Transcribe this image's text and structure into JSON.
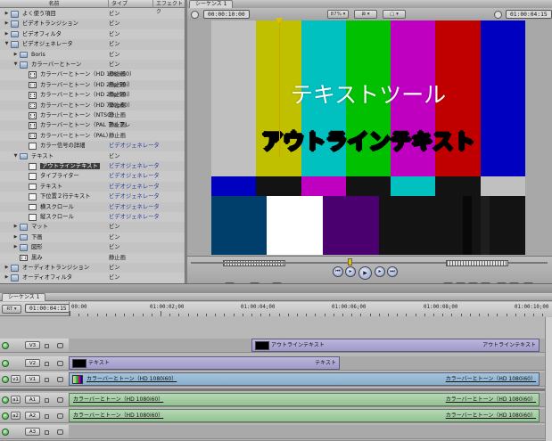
{
  "browser": {
    "columns": [
      "名前",
      "タイプ",
      "エフェクトク"
    ],
    "rows": [
      {
        "label": "よく使う項目",
        "type": "ビン",
        "indent": 0,
        "icon": "folder-icon",
        "tri": "right"
      },
      {
        "label": "ビデオトランジション",
        "type": "ビン",
        "indent": 0,
        "icon": "folder-icon",
        "tri": "right"
      },
      {
        "label": "ビデオフィルタ",
        "type": "ビン",
        "indent": 0,
        "icon": "folder-icon",
        "tri": "right"
      },
      {
        "label": "ビデオジェネレータ",
        "type": "ビン",
        "indent": 0,
        "icon": "folder-icon",
        "tri": "down"
      },
      {
        "label": "Boris",
        "type": "ビン",
        "indent": 1,
        "icon": "folder-icon",
        "tri": "right"
      },
      {
        "label": "カラーバーとトーン",
        "type": "ビン",
        "indent": 1,
        "icon": "folder-icon",
        "tri": "down"
      },
      {
        "label": "カラーバーとトーン（HD 1080i60）",
        "type": "静止画",
        "indent": 2,
        "icon": "clip-icon",
        "tri": ""
      },
      {
        "label": "カラーバーとトーン（HD 25p/50i）",
        "type": "静止画",
        "indent": 2,
        "icon": "clip-icon",
        "tri": ""
      },
      {
        "label": "カラーバーとトーン（HD 25p/50i）",
        "type": "静止画",
        "indent": 2,
        "icon": "clip-icon",
        "tri": ""
      },
      {
        "label": "カラーバーとトーン（HD 720p60）",
        "type": "静止画",
        "indent": 2,
        "icon": "clip-icon",
        "tri": ""
      },
      {
        "label": "カラーバーとトーン（NTSC）",
        "type": "静止画",
        "indent": 2,
        "icon": "clip-icon",
        "tri": ""
      },
      {
        "label": "カラーバーとトーン（PAL フルフレ",
        "type": "静止画",
        "indent": 2,
        "icon": "clip-icon",
        "tri": ""
      },
      {
        "label": "カラーバーとトーン（PAL）",
        "type": "静止画",
        "indent": 2,
        "icon": "clip-icon",
        "tri": ""
      },
      {
        "label": "カラー信号の詳細",
        "type": "ビデオジェネレータ",
        "indent": 2,
        "icon": "generator-icon",
        "tri": ""
      },
      {
        "label": "テキスト",
        "type": "ビン",
        "indent": 1,
        "icon": "folder-icon",
        "tri": "down"
      },
      {
        "label": "アウトラインテキスト",
        "type": "ビデオジェネレータ",
        "indent": 2,
        "icon": "generator-icon",
        "tri": "",
        "selected": true
      },
      {
        "label": "タイプライター",
        "type": "ビデオジェネレータ",
        "indent": 2,
        "icon": "generator-icon",
        "tri": ""
      },
      {
        "label": "テキスト",
        "type": "ビデオジェネレータ",
        "indent": 2,
        "icon": "generator-icon",
        "tri": ""
      },
      {
        "label": "下位置２行テキスト",
        "type": "ビデオジェネレータ",
        "indent": 2,
        "icon": "generator-icon",
        "tri": ""
      },
      {
        "label": "横スクロール",
        "type": "ビデオジェネレータ",
        "indent": 2,
        "icon": "generator-icon",
        "tri": ""
      },
      {
        "label": "縦スクロール",
        "type": "ビデオジェネレータ",
        "indent": 2,
        "icon": "generator-icon",
        "tri": ""
      },
      {
        "label": "マット",
        "type": "ビン",
        "indent": 1,
        "icon": "folder-icon",
        "tri": "right"
      },
      {
        "label": "下画",
        "type": "ビン",
        "indent": 1,
        "icon": "folder-icon",
        "tri": "right"
      },
      {
        "label": "図形",
        "type": "ビン",
        "indent": 1,
        "icon": "folder-icon",
        "tri": "right"
      },
      {
        "label": "黒み",
        "type": "静止画",
        "indent": 1,
        "icon": "clip-icon",
        "tri": ""
      },
      {
        "label": "オーディオトランジション",
        "type": "ビン",
        "indent": 0,
        "icon": "folder-icon",
        "tri": "right"
      },
      {
        "label": "オーディオフィルタ",
        "type": "ビン",
        "indent": 0,
        "icon": "folder-icon",
        "tri": "right"
      }
    ]
  },
  "canvas": {
    "tab": "シーケンス 1",
    "duration_timecode": "00:00:10:00",
    "zoom": "87%",
    "current_timecode": "01:00:04:15",
    "overlay_text_top": "テキストツール",
    "overlay_text_outline": "アウトラインテキスト",
    "colors": {
      "bars_top": [
        "#c0c0c0",
        "#c0c000",
        "#00c0c0",
        "#00c000",
        "#c000c0",
        "#c00000",
        "#0000c0"
      ],
      "bars_mid": [
        "#0000c0",
        "#131313",
        "#c000c0",
        "#131313",
        "#00c0c0",
        "#131313",
        "#c0c0c0"
      ]
    }
  },
  "timeline": {
    "tab": "シーケンス 1",
    "render_button": "RT",
    "timecode": "01:00:04:15",
    "ruler_labels": [
      "00:00",
      "01:00:02;00",
      "01:00:04;00",
      "01:00:06;00",
      "01:00:08;00",
      "01:00:10;00"
    ],
    "tracks": {
      "v3": {
        "label": "V3",
        "clip": "アウトラインテキスト",
        "clip_end_label": "アウトラインテキスト"
      },
      "v2": {
        "label": "V2",
        "clip": "テキスト",
        "clip_end_label": "テキスト"
      },
      "v1": {
        "src": "v1",
        "label": "V1",
        "clip": "カラーバーとトーン（HD 1080i60）",
        "clip_end_label": "カラーバーとトーン（HD 1080i60）"
      },
      "a1": {
        "src": "a1",
        "label": "A1",
        "clip": "カラーバーとトーン（HD 1080i60）",
        "clip_end_label": "カラーバーとトーン（HD 1080i60）"
      },
      "a2": {
        "src": "a2",
        "label": "A2",
        "clip": "カラーバーとトーン（HD 1080i60）",
        "clip_end_label": "カラーバーとトーン（HD 1080i60）"
      },
      "a3": {
        "label": "A3"
      }
    }
  }
}
